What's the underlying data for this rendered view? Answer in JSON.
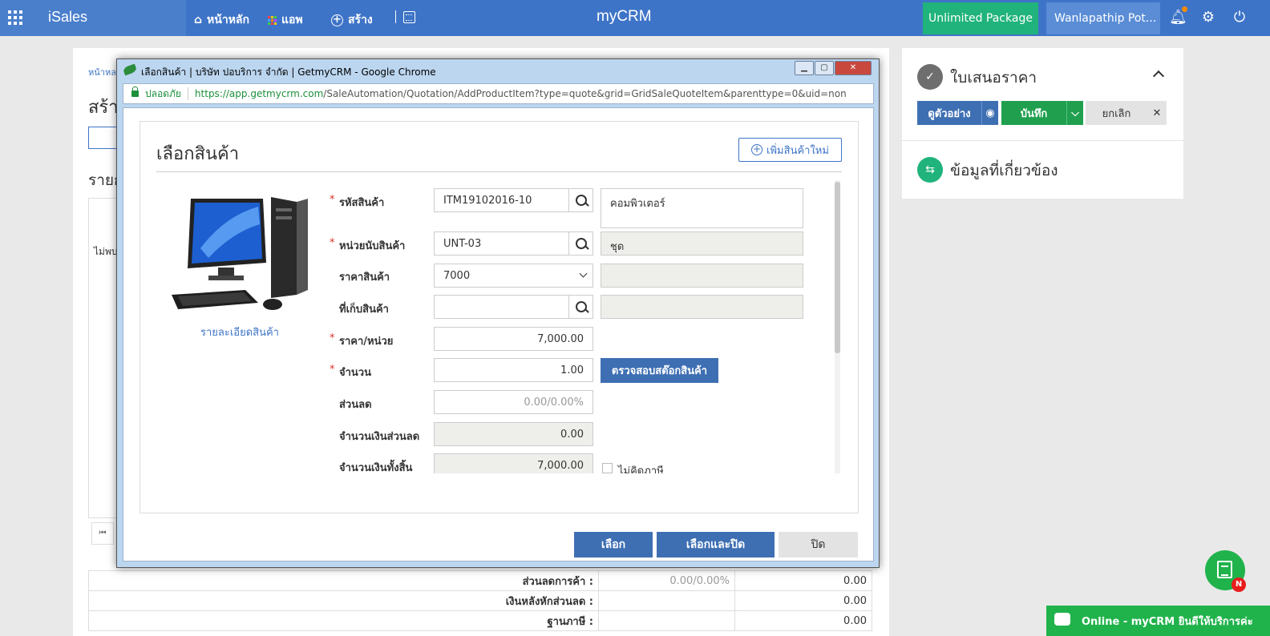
{
  "topbar": {
    "brand": "iSales",
    "nav": [
      {
        "label": "หน้าหลัก",
        "icon": "home-icon"
      },
      {
        "label": "แอพ",
        "icon": "apps-icon"
      },
      {
        "label": "สร้าง",
        "icon": "plus-circle-icon"
      }
    ],
    "logo": "myCRM",
    "package_label": "Unlimited Package",
    "user_label": "Wanlapathip Pot...",
    "colors": {
      "primary": "#3e74c7",
      "accent_green": "#20b37b"
    }
  },
  "background": {
    "breadcrumb": "หน้าหล",
    "heading": "สร้า",
    "section": "รายก",
    "empty_text": "ไม่พบ",
    "summary": [
      {
        "label": "ส่วนลดการค้า :",
        "value1": "0.00/0.00%",
        "value2": "0.00"
      },
      {
        "label": "เงินหลังหักส่วนลด :",
        "value1": "",
        "value2": "0.00"
      },
      {
        "label": "ฐานภาษี :",
        "value1": "",
        "value2": "0.00"
      }
    ]
  },
  "right_panel": {
    "title": "ใบเสนอราคา",
    "preview_label": "ดูตัวอย่าง",
    "save_label": "บันทึก",
    "cancel_label": "ยกเลิก",
    "related_title": "ข้อมูลที่เกี่ยวข้อง"
  },
  "popup": {
    "window_title": "เลือกสินค้า | บริษัท ปอบริการ จำกัด | GetmyCRM - Google Chrome",
    "secure_label": "ปลอดภัย",
    "url_host": "https://app.getmycrm.com",
    "url_path": "/SaleAutomation/Quotation/AddProductItem?type=quote&grid=GridSaleQuoteItem&parenttype=0&uid=non",
    "title": "เลือกสินค้า",
    "add_new_label": "เพิ่มสินค้าใหม่",
    "product_detail_link": "รายละเอียดสินค้า",
    "fields": {
      "product_code": {
        "label": "รหัสสินค้า",
        "value": "ITM19102016-10",
        "name": "คอมพิวเตอร์"
      },
      "unit": {
        "label": "หน่วยนับสินค้า",
        "value": "UNT-03",
        "name": "ชุด"
      },
      "price": {
        "label": "ราคาสินค้า",
        "value": "7000"
      },
      "warehouse": {
        "label": "ที่เก็บสินค้า",
        "value": ""
      },
      "unit_price": {
        "label": "ราคา/หน่วย",
        "value": "7,000.00"
      },
      "quantity": {
        "label": "จำนวน",
        "value": "1.00"
      },
      "discount": {
        "label": "ส่วนลด",
        "value": "0.00/0.00%"
      },
      "discount_amount": {
        "label": "จำนวนเงินส่วนลด",
        "value": "0.00"
      },
      "total_amount": {
        "label": "จำนวนเงินทั้งสิ้น",
        "value": "7,000.00"
      }
    },
    "check_stock_label": "ตรวจสอบสต๊อกสินค้า",
    "no_tax_label": "ไม่คิดภาษี",
    "buttons": {
      "select": "เลือก",
      "select_close": "เลือกและปิด",
      "close": "ปิด"
    }
  },
  "chat": {
    "badge": "N",
    "bar_label": "Online - myCRM ยินดีให้บริการค่ะ"
  }
}
